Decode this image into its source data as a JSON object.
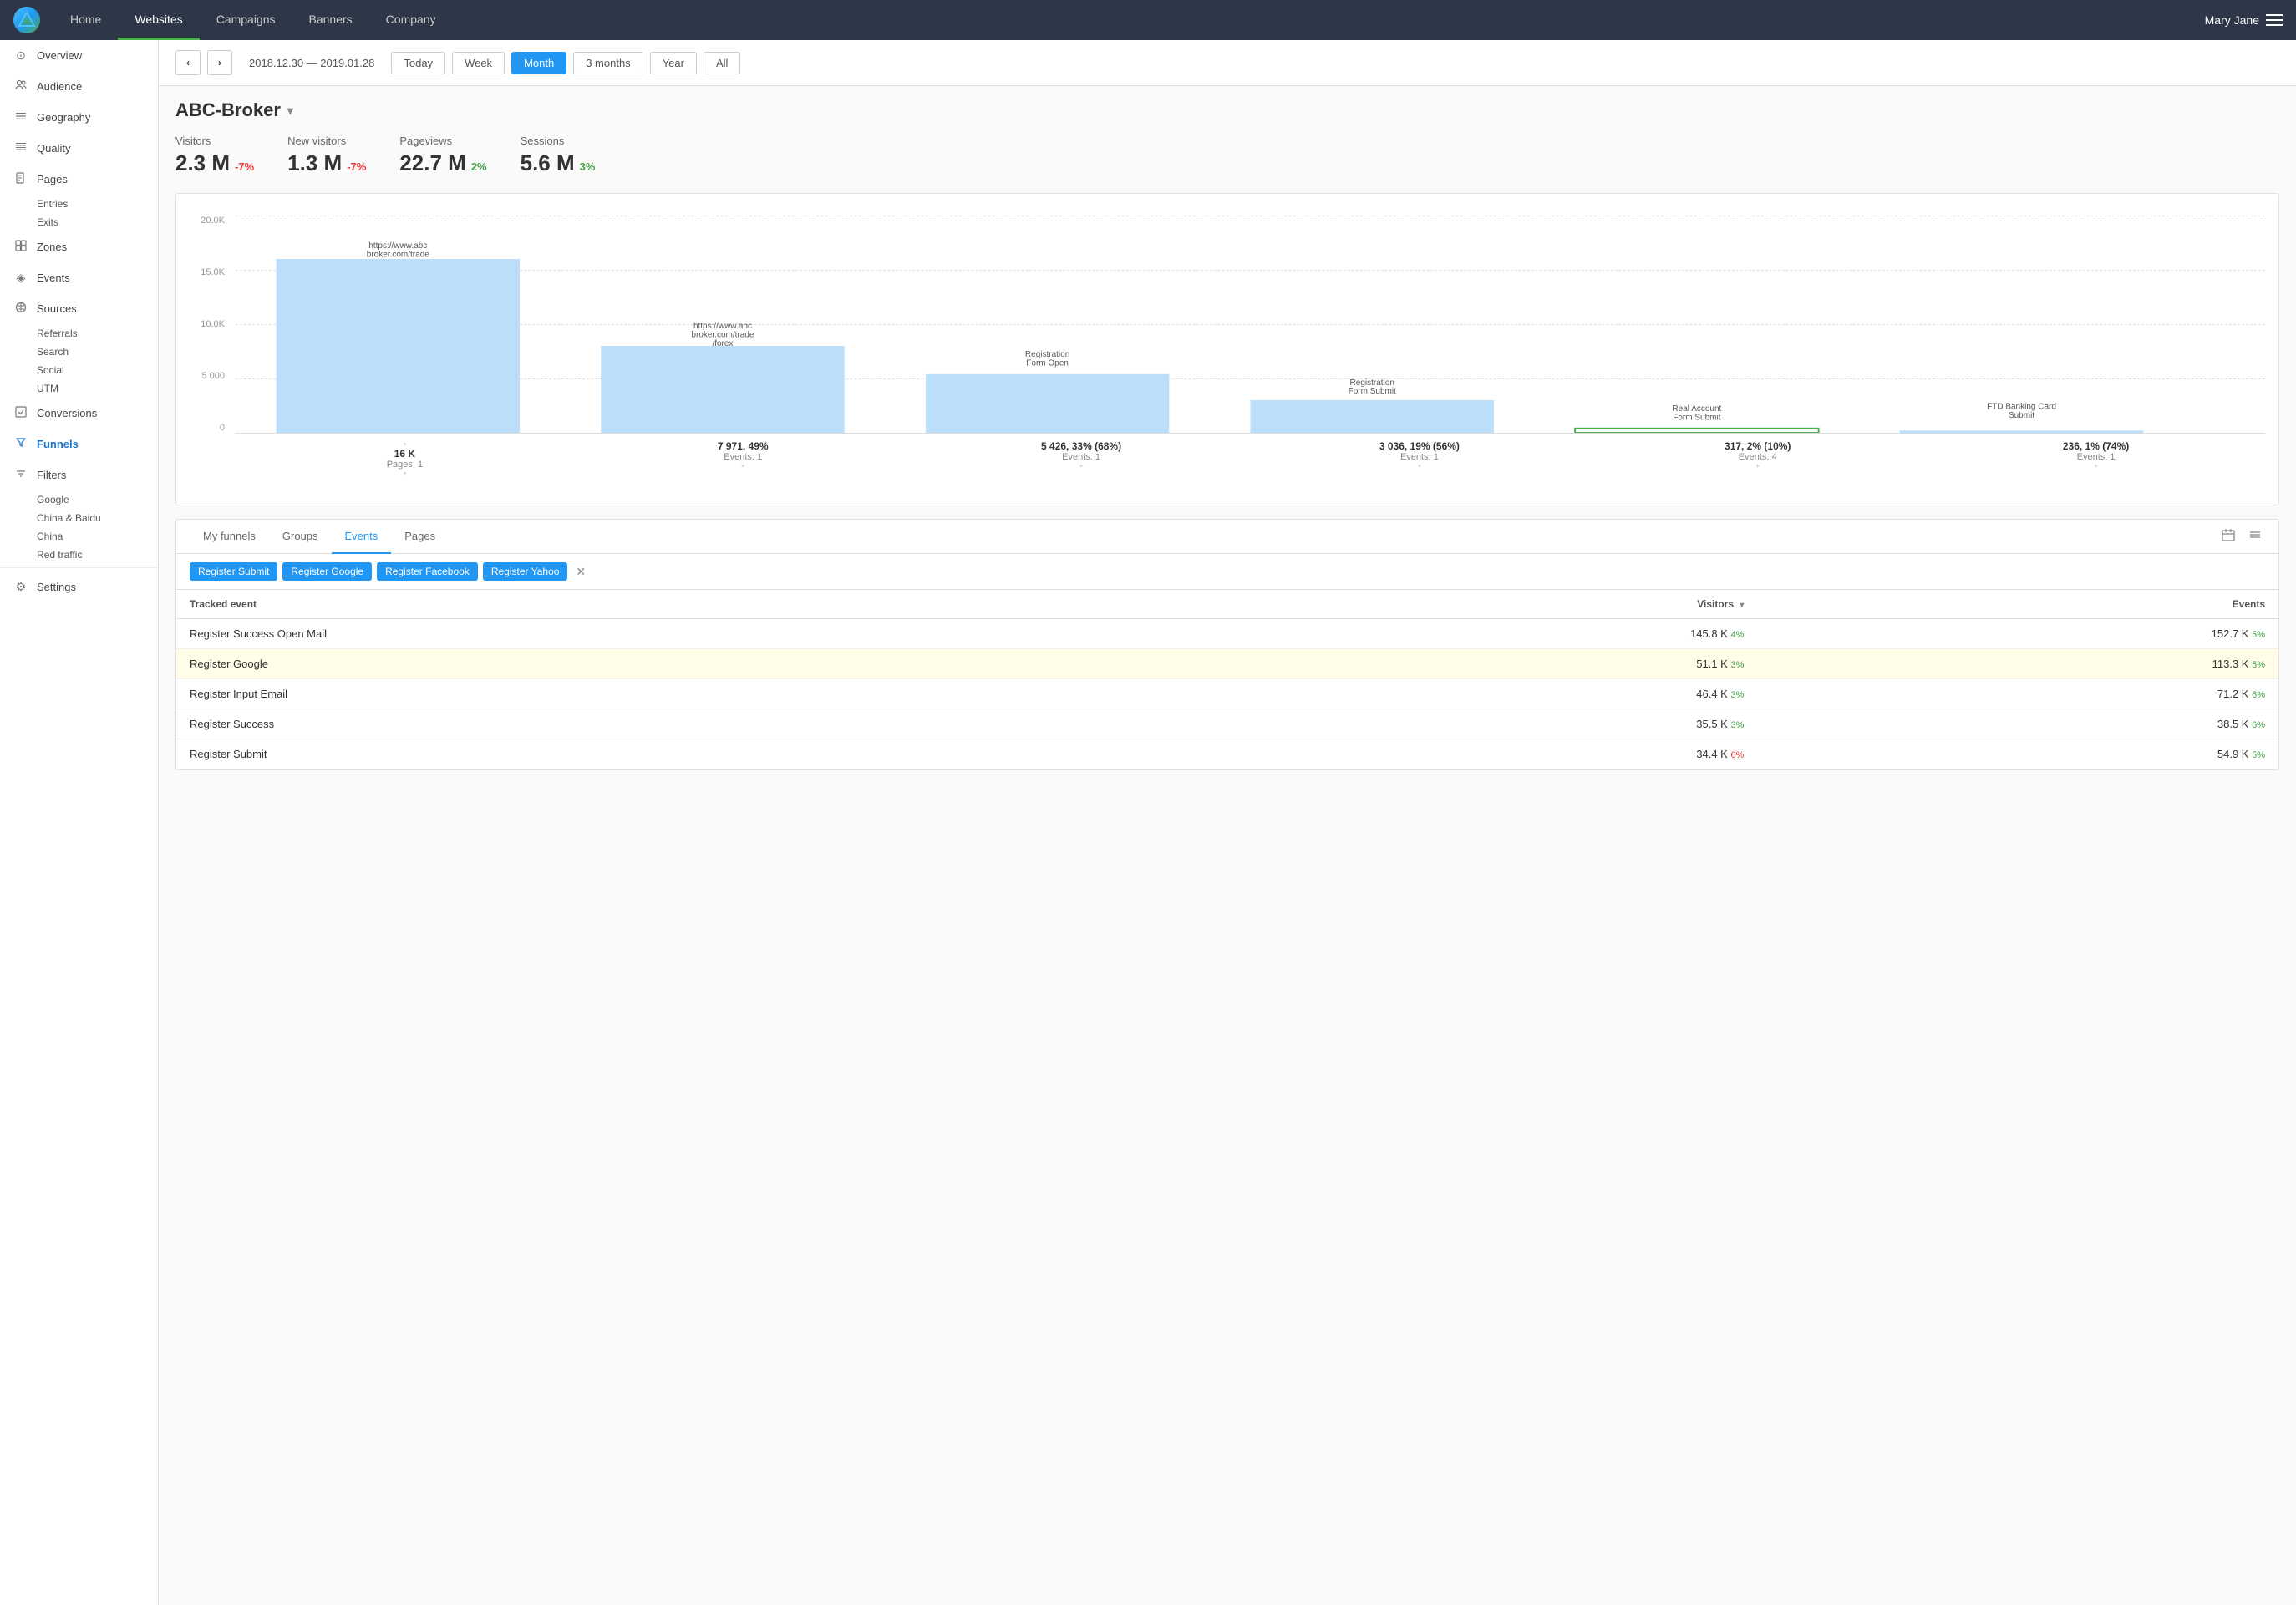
{
  "app": {
    "logo_text": "▲"
  },
  "topnav": {
    "links": [
      {
        "label": "Home",
        "active": false
      },
      {
        "label": "Websites",
        "active": true
      },
      {
        "label": "Campaigns",
        "active": false
      },
      {
        "label": "Banners",
        "active": false
      },
      {
        "label": "Company",
        "active": false
      }
    ],
    "user": "Mary Jane"
  },
  "sidebar": {
    "items": [
      {
        "label": "Overview",
        "icon": "⊙",
        "active": false
      },
      {
        "label": "Audience",
        "icon": "👤",
        "active": false
      },
      {
        "label": "Geography",
        "icon": "≡",
        "active": false
      },
      {
        "label": "Quality",
        "icon": "≣",
        "active": false
      },
      {
        "label": "Pages",
        "icon": "📄",
        "active": false
      },
      {
        "label": "Zones",
        "icon": "⊞",
        "active": false
      },
      {
        "label": "Events",
        "icon": "◈",
        "active": false
      },
      {
        "label": "Sources",
        "icon": "⊘",
        "active": false
      },
      {
        "label": "Conversions",
        "icon": "⊡",
        "active": false
      },
      {
        "label": "Funnels",
        "icon": "▽",
        "active": true
      },
      {
        "label": "Filters",
        "icon": "≔",
        "active": false
      },
      {
        "label": "Settings",
        "icon": "⚙",
        "active": false
      }
    ],
    "subitems_pages": [
      "Entries",
      "Exits"
    ],
    "subitems_sources": [
      "Referrals",
      "Search",
      "Social",
      "UTM"
    ],
    "subitems_filters": [
      "Google",
      "China & Baidu",
      "China",
      "Red traffic"
    ]
  },
  "datebar": {
    "prev_label": "‹",
    "next_label": "›",
    "date_range": "2018.12.30 — 2019.01.28",
    "time_buttons": [
      "Today",
      "Week",
      "Month",
      "3 months",
      "Year",
      "All"
    ],
    "active_time": "Month"
  },
  "website": {
    "name": "ABC-Broker"
  },
  "stats": [
    {
      "label": "Visitors",
      "value": "2.3 M",
      "change": "-7%",
      "change_type": "neg"
    },
    {
      "label": "New visitors",
      "value": "1.3 M",
      "change": "-7%",
      "change_type": "neg"
    },
    {
      "label": "Pageviews",
      "value": "22.7 M",
      "change": "2%",
      "change_type": "pos"
    },
    {
      "label": "Sessions",
      "value": "5.6 M",
      "change": "3%",
      "change_type": "pos"
    }
  ],
  "funnel": {
    "y_labels": [
      "20.0K",
      "15.0K",
      "10.0K",
      "5 000",
      "0"
    ],
    "steps": [
      {
        "tooltip": "https://www.abc\nbroker.com/trade",
        "bar_height_pct": 80,
        "main_label": "16 K",
        "sub_label": "Pages: 1",
        "highlighted": false
      },
      {
        "tooltip": "https://www.abc\nbroker.com/trade\n/forex",
        "bar_height_pct": 50,
        "main_label": "7 971, 49%",
        "sub_label": "Events: 1",
        "highlighted": false
      },
      {
        "tooltip": "Registration\nForm Open",
        "bar_height_pct": 34,
        "main_label": "5 426, 33% (68%)",
        "sub_label": "Events: 1",
        "highlighted": false
      },
      {
        "tooltip": "Registration\nForm Submit",
        "bar_height_pct": 20,
        "main_label": "3 036, 19% (56%)",
        "sub_label": "Events: 1",
        "highlighted": false
      },
      {
        "tooltip": "Real Account\nForm Submit",
        "bar_height_pct": 2,
        "main_label": "317, 2% (10%)",
        "sub_label": "Events: 4",
        "highlighted": true
      },
      {
        "tooltip": "FTD Banking Card\nSubmit",
        "bar_height_pct": 1.5,
        "main_label": "236, 1% (74%)",
        "sub_label": "Events: 1",
        "highlighted": false
      }
    ]
  },
  "tabs": {
    "items": [
      "My funnels",
      "Groups",
      "Events",
      "Pages"
    ],
    "active": "Events"
  },
  "filter_tags": [
    "Register Submit",
    "Register Google",
    "Register Facebook",
    "Register Yahoo"
  ],
  "table": {
    "columns": [
      {
        "label": "Tracked event",
        "sortable": false
      },
      {
        "label": "Visitors ▾",
        "sortable": true,
        "align": "right"
      },
      {
        "label": "Events",
        "sortable": false,
        "align": "right"
      }
    ],
    "rows": [
      {
        "event": "Register Success Open Mail",
        "visitors": "145.8 K",
        "visitors_badge": "4%",
        "visitors_badge_type": "pos",
        "events": "152.7 K",
        "events_badge": "5%",
        "events_badge_type": "pos",
        "highlighted": false
      },
      {
        "event": "Register Google",
        "visitors": "51.1 K",
        "visitors_badge": "3%",
        "visitors_badge_type": "pos",
        "events": "113.3 K",
        "events_badge": "5%",
        "events_badge_type": "pos",
        "highlighted": true
      },
      {
        "event": "Register Input Email",
        "visitors": "46.4 K",
        "visitors_badge": "3%",
        "visitors_badge_type": "pos",
        "events": "71.2 K",
        "events_badge": "6%",
        "events_badge_type": "pos",
        "highlighted": false
      },
      {
        "event": "Register Success",
        "visitors": "35.5 K",
        "visitors_badge": "3%",
        "visitors_badge_type": "pos",
        "events": "38.5 K",
        "events_badge": "6%",
        "events_badge_type": "pos",
        "highlighted": false
      },
      {
        "event": "Register Submit",
        "visitors": "34.4 K",
        "visitors_badge": "6%",
        "visitors_badge_type": "pos",
        "events": "54.9 K",
        "events_badge": "5%",
        "events_badge_type": "pos",
        "highlighted": false
      }
    ]
  }
}
